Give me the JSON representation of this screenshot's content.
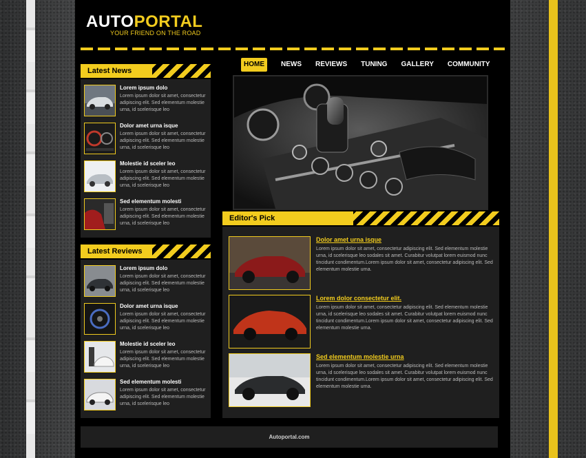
{
  "brand": {
    "logo_auto": "AUTO",
    "logo_portal": "PORTAL",
    "tagline": "YOUR FRIEND ON THE ROAD"
  },
  "nav": [
    "HOME",
    "NEWS",
    "REVIEWS",
    "TUNING",
    "GALLERY",
    "COMMUNITY"
  ],
  "latest_news": {
    "title": "Latest News",
    "items": [
      {
        "title": "Lorem ipsum dolo",
        "body": "Lorem ipsum dolor sit amet, consectetur adipiscing elit. Sed elementum molestie urna, id scelerisque leo"
      },
      {
        "title": "Dolor amet urna isque",
        "body": "Lorem ipsum dolor sit amet, consectetur adipiscing elit. Sed elementum molestie urna, id scelerisque leo"
      },
      {
        "title": "Molestie id sceler leo",
        "body": "Lorem ipsum dolor sit amet, consectetur adipiscing elit. Sed elementum molestie urna, id scelerisque leo"
      },
      {
        "title": "Sed elementum molesti",
        "body": "Lorem ipsum dolor sit amet, consectetur adipiscing elit. Sed elementum molestie urna, id scelerisque leo"
      }
    ]
  },
  "latest_reviews": {
    "title": "Latest Reviews",
    "items": [
      {
        "title": "Lorem ipsum dolo",
        "body": "Lorem ipsum dolor sit amet, consectetur adipiscing elit. Sed elementum molestie urna, id scelerisque leo"
      },
      {
        "title": "Dolor amet urna isque",
        "body": "Lorem ipsum dolor sit amet, consectetur adipiscing elit. Sed elementum molestie urna, id scelerisque leo"
      },
      {
        "title": "Molestie id sceler leo",
        "body": "Lorem ipsum dolor sit amet, consectetur adipiscing elit. Sed elementum molestie urna, id scelerisque leo"
      },
      {
        "title": "Sed elementum molesti",
        "body": "Lorem ipsum dolor sit amet, consectetur adipiscing elit. Sed elementum molestie urna, id scelerisque leo"
      }
    ]
  },
  "editors_pick": {
    "title": "Editor's Pick",
    "items": [
      {
        "title": "Dolor amet urna isque",
        "body": "Lorem ipsum dolor sit amet, consectetur adipiscing elit. Sed elementum molestie urna, id scelerisque leo sodales sit amet. Curabitur volutpat lorem euismod nunc tincidunt condimentum.Lorem ipsum dolor sit amet, consectetur adipiscing elit. Sed elementum molestie urna."
      },
      {
        "title": "Lorem dolor consectetur elit.",
        "body": "Lorem ipsum dolor sit amet, consectetur adipiscing elit. Sed elementum molestie urna, id scelerisque leo sodales sit amet. Curabitur volutpat lorem euismod nunc tincidunt condimentum.Lorem ipsum dolor sit amet, consectetur adipiscing elit. Sed elementum molestie urna."
      },
      {
        "title": "Sed elementum molestie urna",
        "body": "Lorem ipsum dolor sit amet, consectetur adipiscing elit. Sed elementum molestie urna, id scelerisque leo sodales sit amet. Curabitur volutpat lorem euismod nunc tincidunt condimentum.Lorem ipsum dolor sit amet, consectetur adipiscing elit. Sed elementum molestie urna."
      }
    ]
  },
  "footer": {
    "text": "Autoportal.com"
  },
  "colors": {
    "accent": "#f2cc1e",
    "panel": "#1f1f1f",
    "page": "#000000"
  }
}
